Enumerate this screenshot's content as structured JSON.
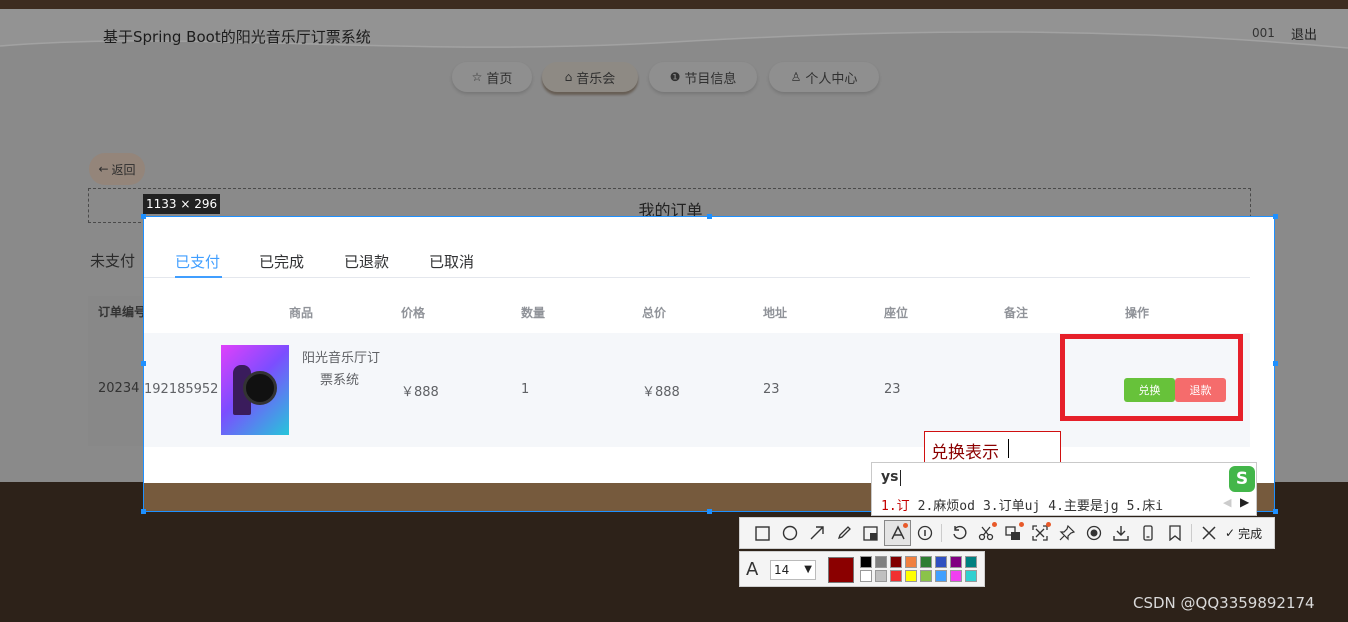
{
  "header": {
    "site_title": "基于Spring Boot的阳光音乐厅订票系统",
    "user_id": "001",
    "logout": "退出"
  },
  "nav": [
    {
      "icon": "star-icon",
      "glyph": "☆",
      "label": "首页"
    },
    {
      "icon": "bag-icon",
      "glyph": "⌂",
      "label": "音乐会"
    },
    {
      "icon": "info-icon",
      "glyph": "❶",
      "label": "节目信息"
    },
    {
      "icon": "user-icon",
      "glyph": "♙",
      "label": "个人中心"
    }
  ],
  "back_label": "返回",
  "order_title": "我的订单",
  "selection_size": "1133 × 296",
  "tabs": {
    "unpaid": "未支付",
    "paid": "已支付",
    "completed": "已完成",
    "refunded": "已退款",
    "cancelled": "已取消"
  },
  "table": {
    "headers": {
      "order_no": "订单编号",
      "product": "商品",
      "price": "价格",
      "qty": "数量",
      "total": "总价",
      "address": "地址",
      "seat": "座位",
      "note": "备注",
      "action": "操作"
    },
    "row": {
      "order_no_left": "20234",
      "order_no_right": "192185952",
      "product_line1": "阳光音乐厅订",
      "product_line2": "票系统",
      "price": "￥888",
      "qty": "1",
      "total": "￥888",
      "address": "23",
      "seat": "23",
      "note": ""
    },
    "btn_exchange": "兑换",
    "btn_refund": "退款"
  },
  "annotation_text": "兑换表示",
  "ime": {
    "input": "ys",
    "candidates": [
      "1.订",
      "2.麻烦od",
      "3.订单uj",
      "4.主要是jg",
      "5.床i"
    ],
    "logo": "S"
  },
  "toolbar": {
    "tools": [
      "rect-icon",
      "ellipse-icon",
      "arrow-icon",
      "pencil-icon",
      "mosaic-icon",
      "text-icon",
      "number-icon",
      "undo-icon",
      "cut-icon",
      "ocr-icon",
      "scan-icon",
      "pin-icon",
      "record-icon",
      "download-icon",
      "phone-icon",
      "bookmark-icon",
      "close-icon"
    ],
    "done_label": "完成"
  },
  "style_bar": {
    "font_size": "14",
    "current_color": "#8b0000",
    "swatches": [
      "#000000",
      "#808080",
      "#800000",
      "#f08040",
      "#2e7d32",
      "#3050c0",
      "#800080",
      "#008080",
      "#ffffff",
      "#c0c0c0",
      "#f03030",
      "#ffff00",
      "#8bc34a",
      "#40a0ff",
      "#f040f0",
      "#30d0d0"
    ]
  },
  "watermark": "CSDN @QQ3359892174"
}
